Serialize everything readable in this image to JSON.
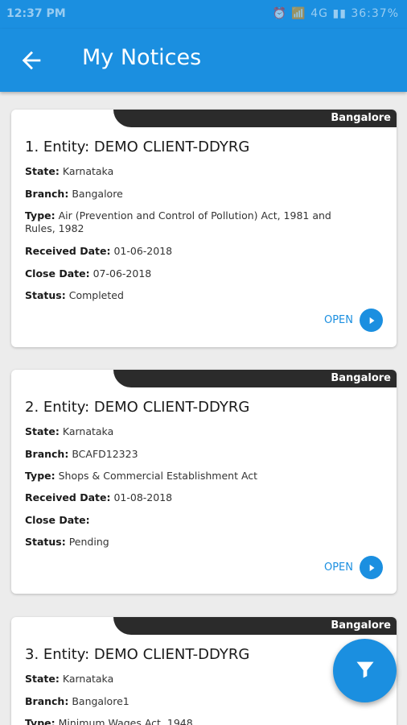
{
  "status_bar": {
    "time": "12:37 PM",
    "icons": "⏰ 📶 4G ▮▮ 36:37%"
  },
  "app_bar": {
    "title": "My Notices"
  },
  "colors": {
    "primary": "#1b8fe0",
    "tag_bg": "#2b2b2b"
  },
  "notices": [
    {
      "tag": "Bangalore",
      "entity": "1. Entity: DEMO CLIENT-DDYRG",
      "state_label": "State:",
      "state": "Karnataka",
      "branch_label": "Branch:",
      "branch": "Bangalore",
      "type_label": "Type:",
      "type": "Air (Prevention and Control of Pollution) Act, 1981 and Rules, 1982",
      "received_label": "Received Date:",
      "received": "01-06-2018",
      "close_label": "Close Date:",
      "close": "07-06-2018",
      "status_label": "Status:",
      "status": "Completed",
      "open_label": "OPEN"
    },
    {
      "tag": "Bangalore",
      "entity": "2. Entity: DEMO CLIENT-DDYRG",
      "state_label": "State:",
      "state": "Karnataka",
      "branch_label": "Branch:",
      "branch": "BCAFD12323",
      "type_label": "Type:",
      "type": "Shops & Commercial Establishment Act",
      "received_label": "Received Date:",
      "received": "01-08-2018",
      "close_label": "Close Date:",
      "close": "",
      "status_label": "Status:",
      "status": "Pending",
      "open_label": "OPEN"
    },
    {
      "tag": "Bangalore",
      "entity": "3. Entity: DEMO CLIENT-DDYRG",
      "state_label": "State:",
      "state": "Karnataka",
      "branch_label": "Branch:",
      "branch": "Bangalore1",
      "type_label": "Type:",
      "type": "Minimum Wages Act, 1948"
    }
  ],
  "fab": {
    "icon": "filter-icon"
  }
}
